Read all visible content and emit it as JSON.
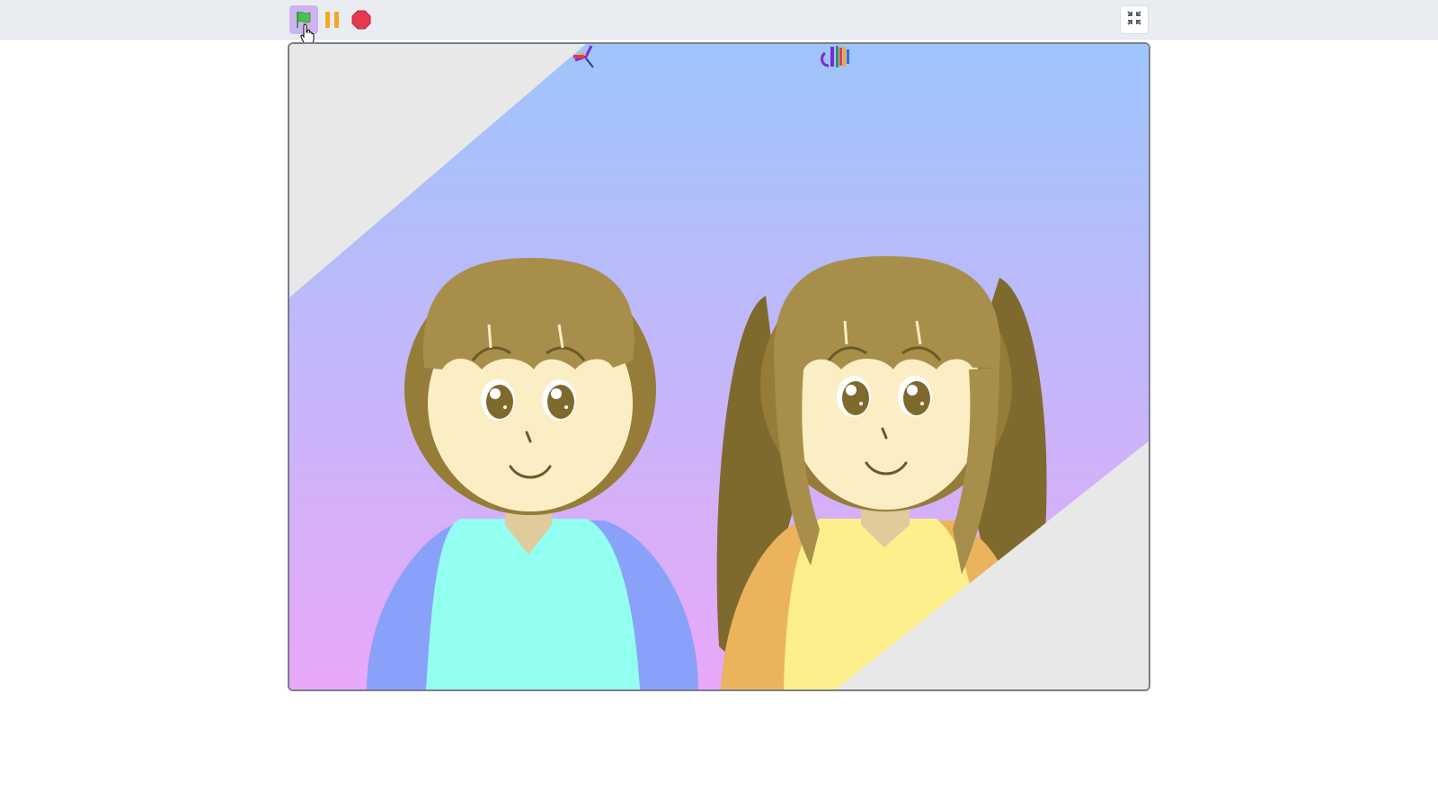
{
  "toolbar": {
    "green_flag_icon": "green-flag-icon",
    "pause_icon": "pause-icon",
    "stop_icon": "stop-icon",
    "unfullscreen_icon": "unfullscreen-icon"
  },
  "colors": {
    "toolbar_bg": "#e9edf1",
    "flag_active_bg": "#cdb4f0",
    "flag_green": "#4cbf56",
    "pause_yellow": "#f5a623",
    "stop_red": "#e8384f",
    "stage_border": "#7a7f88",
    "sky_top": "#9ec5fa",
    "sky_bottom": "#e9a8f9",
    "corner_gray": "#e8e8e8",
    "hair_boy": "#a78f4b",
    "hair_girl": "#7f6a2e",
    "skin": "#fbeec4",
    "shirt_boy": "#93fff0",
    "sleeve_boy": "#8aa1f9",
    "shirt_girl": "#fdef8c",
    "sleeve_girl": "#ebb35c"
  },
  "stage": {
    "sprites": [
      "boy-character",
      "girl-character",
      "glitch-sprite-left",
      "glitch-sprite-right"
    ]
  }
}
